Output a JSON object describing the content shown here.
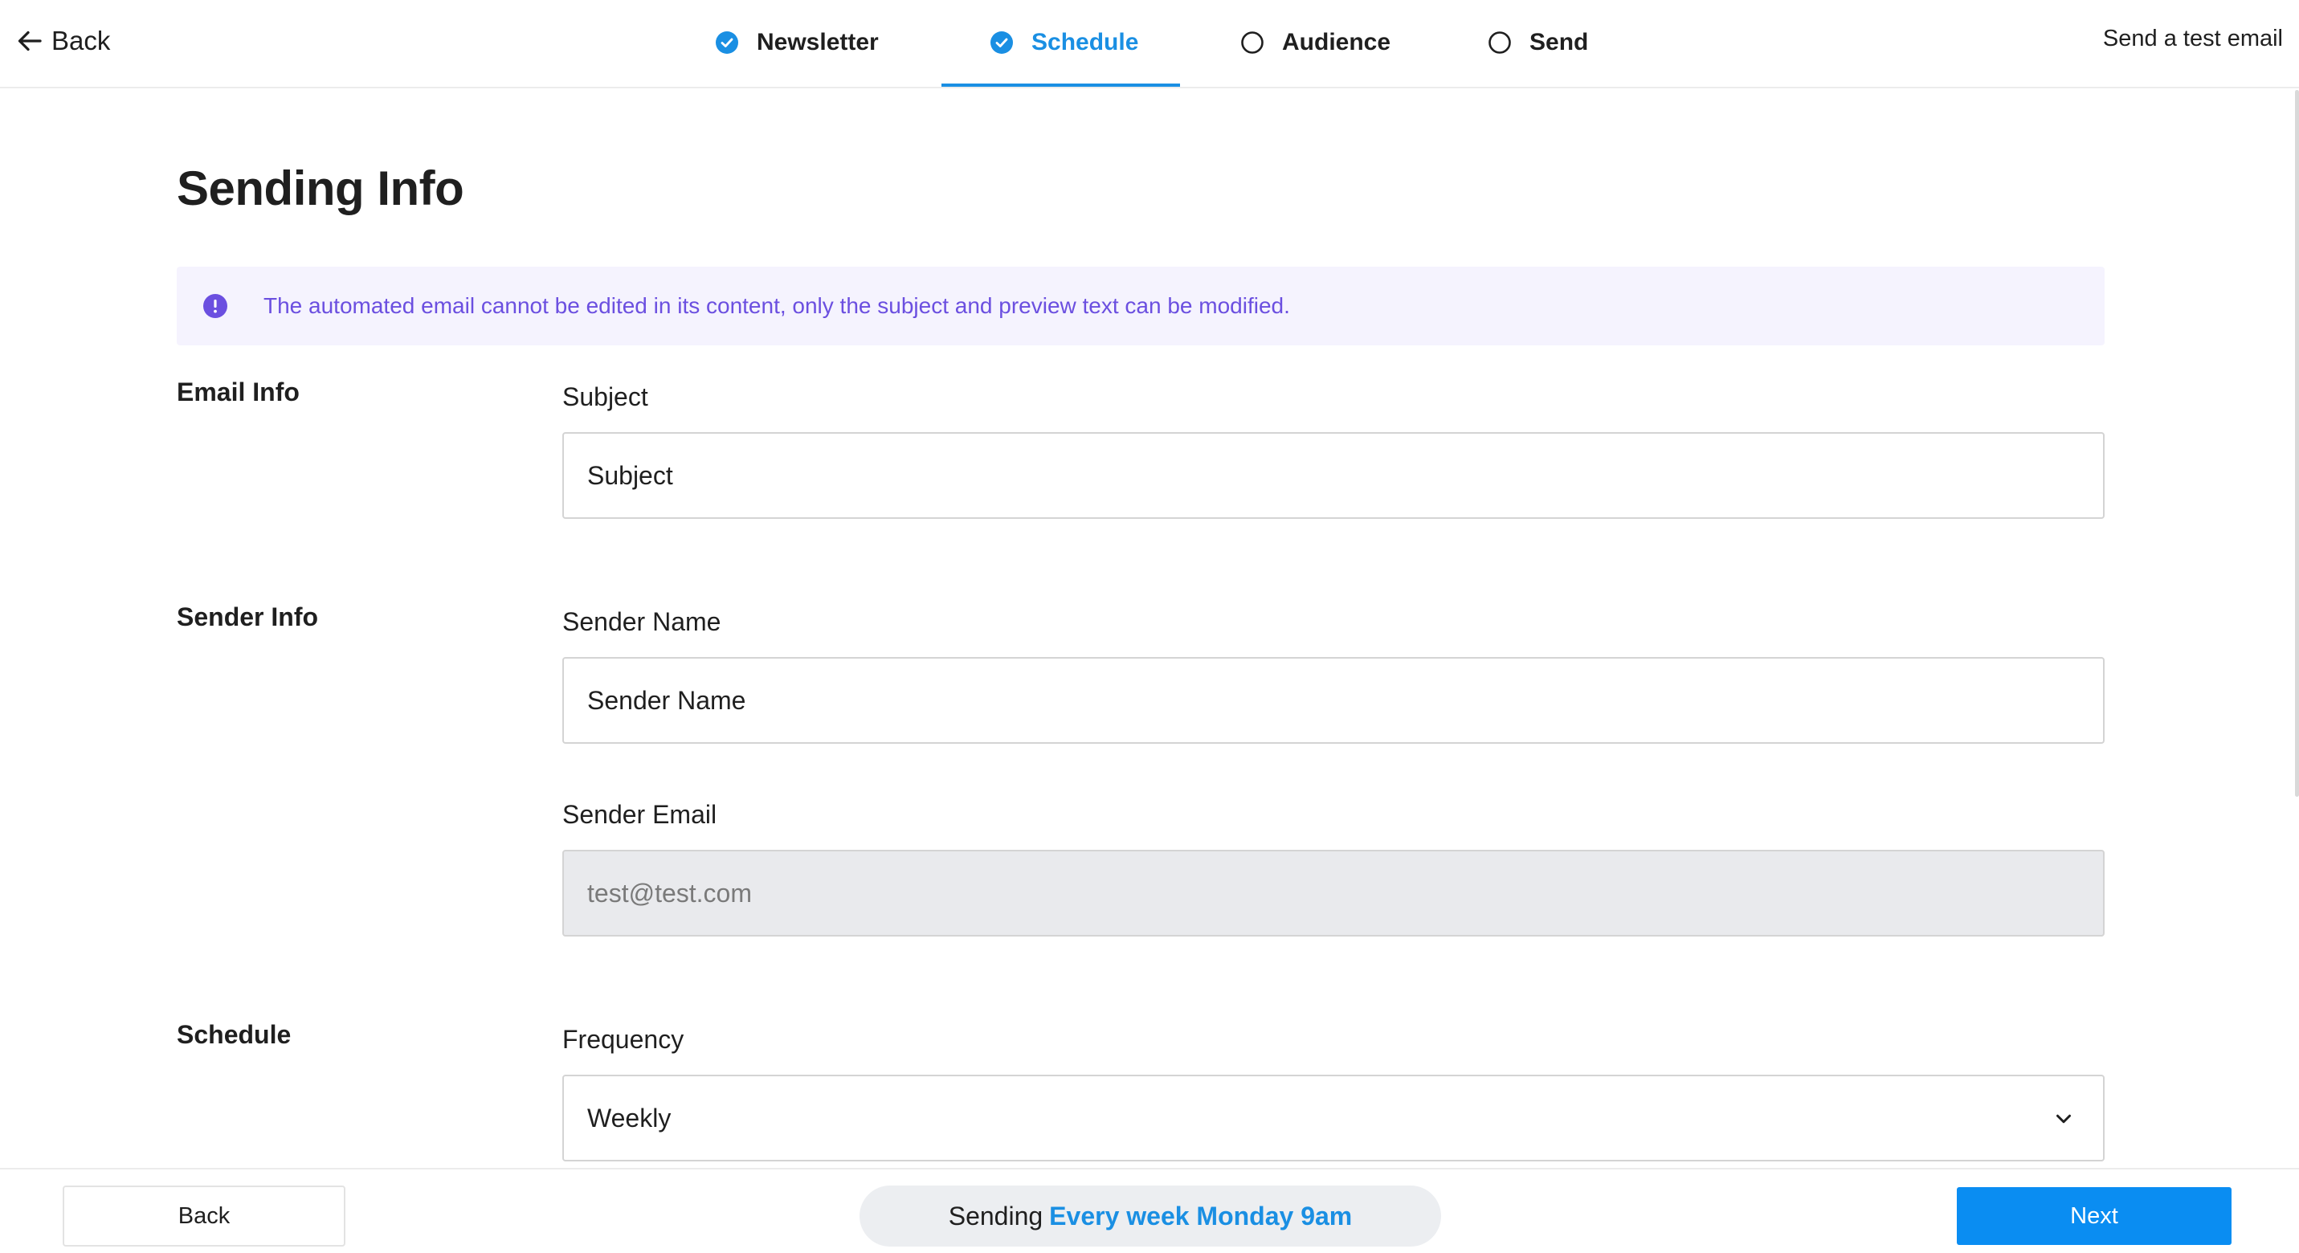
{
  "colors": {
    "accent": "#1a8fe3",
    "notice_text": "#6b4fe0",
    "notice_bg": "#f5f3fe",
    "next_button": "#0a8df2",
    "disabled_input": "#e9eaed"
  },
  "topbar": {
    "back_label": "Back",
    "test_email_label": "Send a test email",
    "steps": [
      {
        "label": "Newsletter",
        "state": "completed",
        "icon": "check-circle-icon"
      },
      {
        "label": "Schedule",
        "state": "active",
        "icon": "check-circle-icon"
      },
      {
        "label": "Audience",
        "state": "pending",
        "icon": "empty-circle-icon"
      },
      {
        "label": "Send",
        "state": "pending",
        "icon": "empty-circle-icon"
      }
    ]
  },
  "main": {
    "title": "Sending Info",
    "notice": {
      "icon": "info-icon",
      "text": "The automated email cannot be edited in its content, only the subject and preview text can be modified."
    },
    "email_info": {
      "section_label": "Email Info",
      "subject_label": "Subject",
      "subject_placeholder": "Subject"
    },
    "sender_info": {
      "section_label": "Sender Info",
      "name_label": "Sender Name",
      "name_placeholder": "Sender Name",
      "email_label": "Sender Email",
      "email_value": "test@test.com"
    },
    "schedule": {
      "section_label": "Schedule",
      "frequency_label": "Frequency",
      "frequency_value": "Weekly"
    }
  },
  "bottombar": {
    "back_label": "Back",
    "sending_prefix": "Sending",
    "sending_value": "Every week Monday 9am",
    "next_label": "Next"
  }
}
